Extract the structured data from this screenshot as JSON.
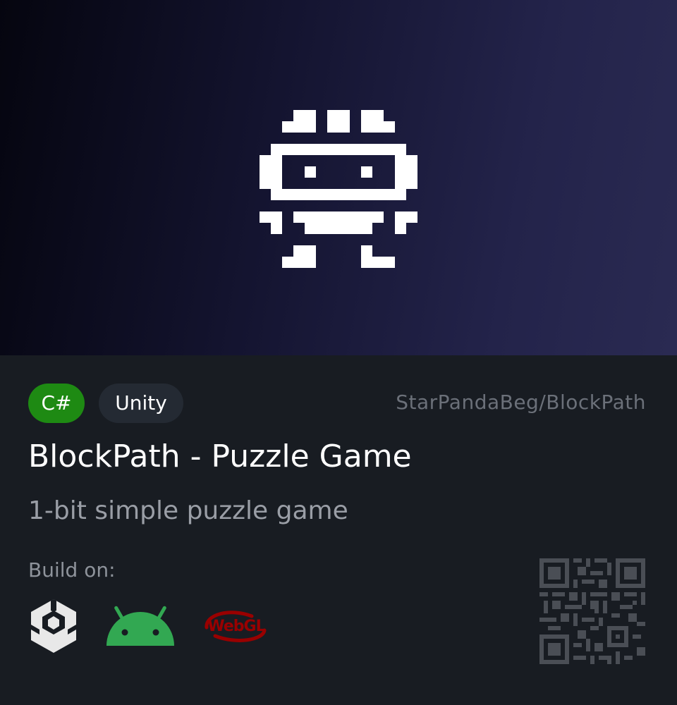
{
  "hero": {
    "icon": "pixel-robot-icon",
    "background_colors": [
      "#05050f",
      "#2a2a52"
    ]
  },
  "tags": [
    {
      "label": "C#",
      "color": "#1e8a13"
    },
    {
      "label": "Unity",
      "color": "#242a33"
    }
  ],
  "repo": "StarPandaBeg/BlockPath",
  "title": "BlockPath - Puzzle Game",
  "subtitle": "1-bit simple puzzle game",
  "build": {
    "label": "Build on:",
    "platforms": [
      {
        "name": "Unity",
        "icon": "unity-icon",
        "color": "#e8e8e8"
      },
      {
        "name": "Android",
        "icon": "android-icon",
        "color": "#32a852"
      },
      {
        "name": "WebGL",
        "icon": "webgl-icon",
        "color": "#990000",
        "text": "WebGL"
      }
    ]
  },
  "qr": {
    "icon": "qr-code-icon",
    "color": "#4a4e55"
  }
}
